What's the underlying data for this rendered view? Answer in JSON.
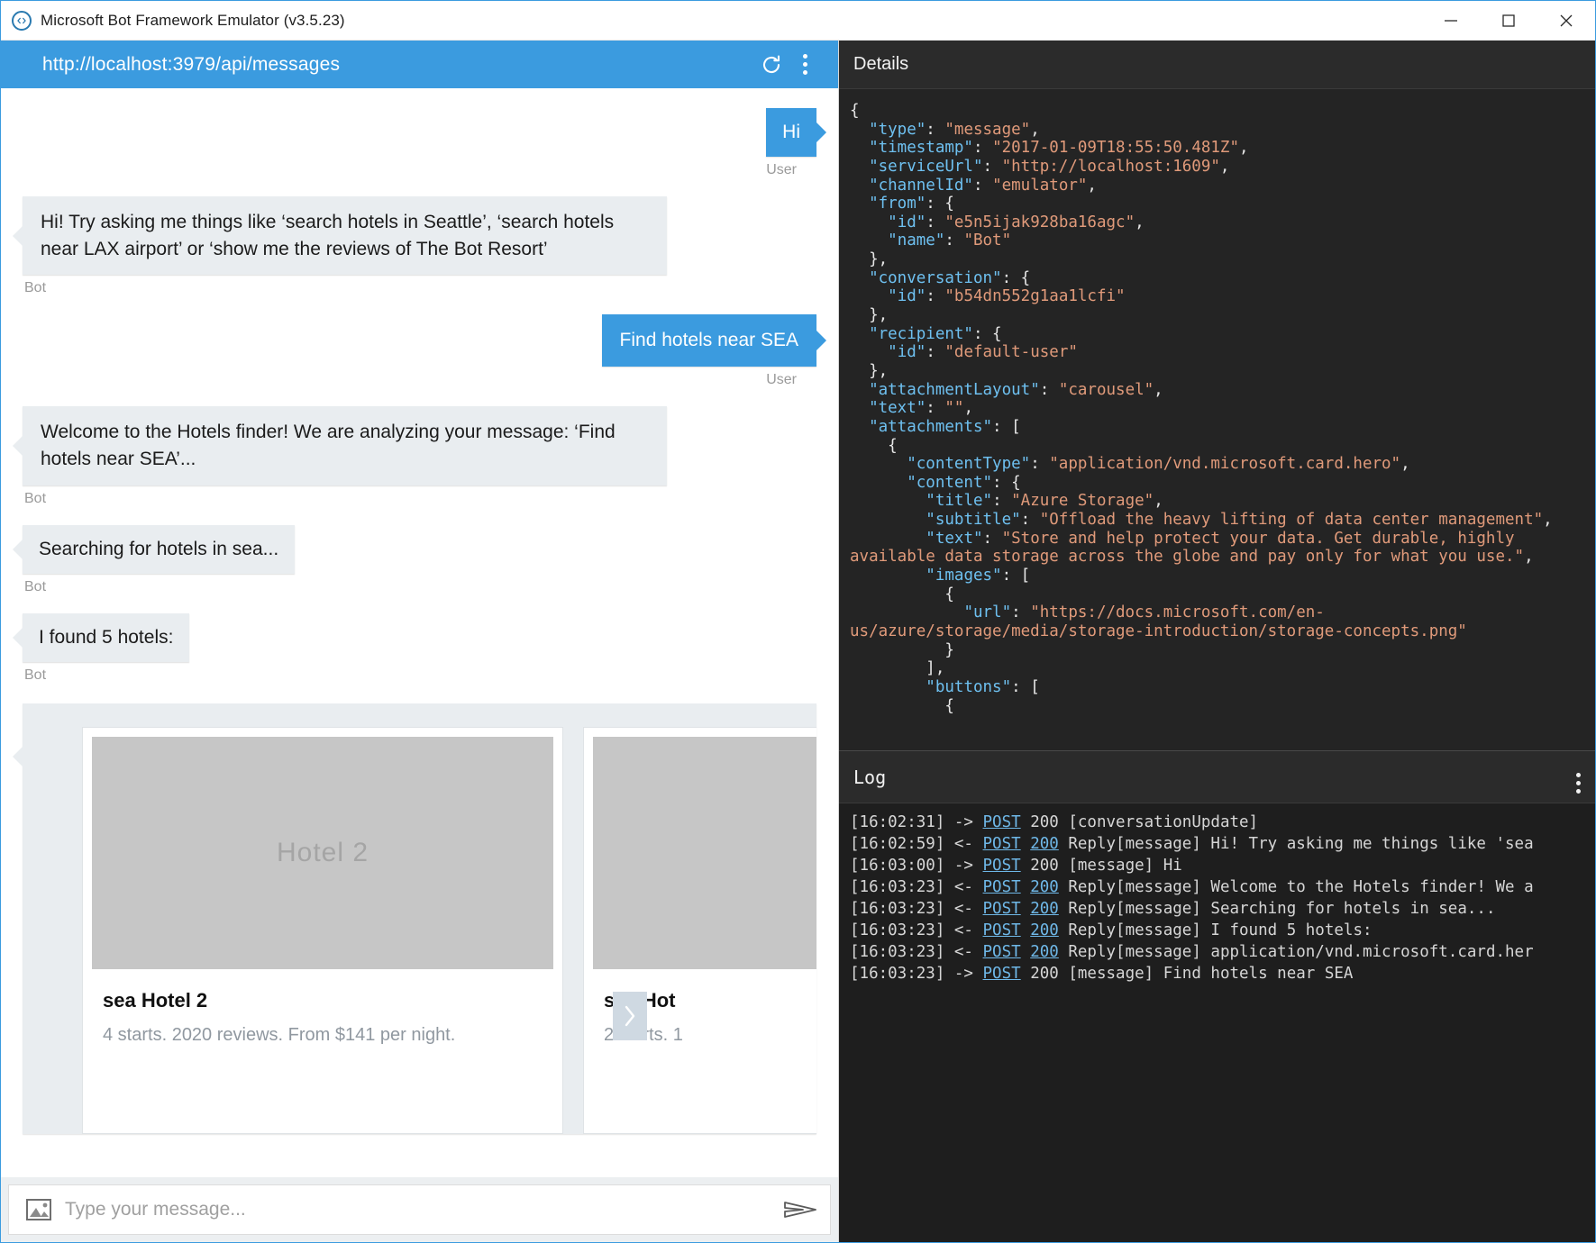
{
  "window": {
    "title": "Microsoft Bot Framework Emulator (v3.5.23)",
    "logo_icon": "bot-framework-logo-icon",
    "minimize_label": "Minimize",
    "maximize_label": "Maximize",
    "close_label": "Close"
  },
  "urlbar": {
    "endpoint": "http://localhost:3979/api/messages",
    "refresh_icon": "refresh-icon",
    "menu_icon": "more-options-icon"
  },
  "chat": {
    "messages": [
      {
        "from": "user",
        "text": "Hi",
        "who": "User"
      },
      {
        "from": "bot",
        "text": "Hi! Try asking me things like ‘search hotels in Seattle’, ‘search hotels near LAX airport’ or ‘show me the reviews of The Bot Resort’",
        "who": "Bot"
      },
      {
        "from": "user",
        "text": "Find hotels near SEA",
        "who": "User"
      },
      {
        "from": "bot",
        "text": "Welcome to the Hotels finder! We are analyzing your message: ‘Find hotels near SEA’...",
        "who": "Bot"
      },
      {
        "from": "bot",
        "text": "Searching for hotels in sea...",
        "who": "Bot"
      },
      {
        "from": "bot",
        "text": "I found 5 hotels:",
        "who": "Bot"
      }
    ],
    "carousel": {
      "next_icon": "chevron-right-icon",
      "cards": [
        {
          "image_label": "Hotel 2",
          "title": "sea Hotel 2",
          "subtitle": "4 starts. 2020 reviews. From $141 per night."
        },
        {
          "image_label": "",
          "title": "sea Hot",
          "subtitle": "2 starts. 1"
        }
      ]
    }
  },
  "composer": {
    "upload_icon": "image-upload-icon",
    "placeholder": "Type your message...",
    "value": "",
    "send_icon": "send-icon"
  },
  "details": {
    "title": "Details",
    "menu_icon": "more-options-icon",
    "json_lines": [
      [
        [
          "p",
          "{"
        ]
      ],
      [
        [
          "p",
          "  "
        ],
        [
          "k",
          "\"type\""
        ],
        [
          "p",
          ": "
        ],
        [
          "s",
          "\"message\""
        ],
        [
          "p",
          ","
        ]
      ],
      [
        [
          "p",
          "  "
        ],
        [
          "k",
          "\"timestamp\""
        ],
        [
          "p",
          ": "
        ],
        [
          "s",
          "\"2017-01-09T18:55:50.481Z\""
        ],
        [
          "p",
          ","
        ]
      ],
      [
        [
          "p",
          "  "
        ],
        [
          "k",
          "\"serviceUrl\""
        ],
        [
          "p",
          ": "
        ],
        [
          "s",
          "\"http://localhost:1609\""
        ],
        [
          "p",
          ","
        ]
      ],
      [
        [
          "p",
          "  "
        ],
        [
          "k",
          "\"channelId\""
        ],
        [
          "p",
          ": "
        ],
        [
          "s",
          "\"emulator\""
        ],
        [
          "p",
          ","
        ]
      ],
      [
        [
          "p",
          "  "
        ],
        [
          "k",
          "\"from\""
        ],
        [
          "p",
          ": {"
        ]
      ],
      [
        [
          "p",
          "    "
        ],
        [
          "k",
          "\"id\""
        ],
        [
          "p",
          ": "
        ],
        [
          "s",
          "\"e5n5ijak928ba16agc\""
        ],
        [
          "p",
          ","
        ]
      ],
      [
        [
          "p",
          "    "
        ],
        [
          "k",
          "\"name\""
        ],
        [
          "p",
          ": "
        ],
        [
          "s",
          "\"Bot\""
        ]
      ],
      [
        [
          "p",
          "  },"
        ]
      ],
      [
        [
          "p",
          "  "
        ],
        [
          "k",
          "\"conversation\""
        ],
        [
          "p",
          ": {"
        ]
      ],
      [
        [
          "p",
          "    "
        ],
        [
          "k",
          "\"id\""
        ],
        [
          "p",
          ": "
        ],
        [
          "s",
          "\"b54dn552g1aa1lcfi\""
        ]
      ],
      [
        [
          "p",
          "  },"
        ]
      ],
      [
        [
          "p",
          "  "
        ],
        [
          "k",
          "\"recipient\""
        ],
        [
          "p",
          ": {"
        ]
      ],
      [
        [
          "p",
          "    "
        ],
        [
          "k",
          "\"id\""
        ],
        [
          "p",
          ": "
        ],
        [
          "s",
          "\"default-user\""
        ]
      ],
      [
        [
          "p",
          "  },"
        ]
      ],
      [
        [
          "p",
          "  "
        ],
        [
          "k",
          "\"attachmentLayout\""
        ],
        [
          "p",
          ": "
        ],
        [
          "s",
          "\"carousel\""
        ],
        [
          "p",
          ","
        ]
      ],
      [
        [
          "p",
          "  "
        ],
        [
          "k",
          "\"text\""
        ],
        [
          "p",
          ": "
        ],
        [
          "s",
          "\"\""
        ],
        [
          "p",
          ","
        ]
      ],
      [
        [
          "p",
          "  "
        ],
        [
          "k",
          "\"attachments\""
        ],
        [
          "p",
          ": ["
        ]
      ],
      [
        [
          "p",
          "    {"
        ]
      ],
      [
        [
          "p",
          "      "
        ],
        [
          "k",
          "\"contentType\""
        ],
        [
          "p",
          ": "
        ],
        [
          "s",
          "\"application/vnd.microsoft.card.hero\""
        ],
        [
          "p",
          ","
        ]
      ],
      [
        [
          "p",
          "      "
        ],
        [
          "k",
          "\"content\""
        ],
        [
          "p",
          ": {"
        ]
      ],
      [
        [
          "p",
          "        "
        ],
        [
          "k",
          "\"title\""
        ],
        [
          "p",
          ": "
        ],
        [
          "s",
          "\"Azure Storage\""
        ],
        [
          "p",
          ","
        ]
      ],
      [
        [
          "p",
          "        "
        ],
        [
          "k",
          "\"subtitle\""
        ],
        [
          "p",
          ": "
        ],
        [
          "s",
          "\"Offload the heavy lifting of data center management\""
        ],
        [
          "p",
          ","
        ]
      ],
      [
        [
          "p",
          "        "
        ],
        [
          "k",
          "\"text\""
        ],
        [
          "p",
          ": "
        ],
        [
          "s",
          "\"Store and help protect your data. Get durable, highly available data storage across the globe and pay only for what you use.\""
        ],
        [
          "p",
          ","
        ]
      ],
      [
        [
          "p",
          "        "
        ],
        [
          "k",
          "\"images\""
        ],
        [
          "p",
          ": ["
        ]
      ],
      [
        [
          "p",
          "          {"
        ]
      ],
      [
        [
          "p",
          "            "
        ],
        [
          "k",
          "\"url\""
        ],
        [
          "p",
          ": "
        ],
        [
          "s",
          "\"https://docs.microsoft.com/en-us/azure/storage/media/storage-introduction/storage-concepts.png\""
        ]
      ],
      [
        [
          "p",
          "          }"
        ]
      ],
      [
        [
          "p",
          "        ],"
        ]
      ],
      [
        [
          "p",
          "        "
        ],
        [
          "k",
          "\"buttons\""
        ],
        [
          "p",
          ": ["
        ]
      ],
      [
        [
          "p",
          "          {"
        ]
      ]
    ]
  },
  "log": {
    "title": "Log",
    "menu_icon": "more-options-icon",
    "entries": [
      {
        "time": "[16:02:31]",
        "dir": "->",
        "method": "POST",
        "status": "200",
        "status_link": false,
        "method_link": true,
        "text": "[conversationUpdate]"
      },
      {
        "time": "[16:02:59]",
        "dir": "<-",
        "method": "POST",
        "status": "200",
        "status_link": true,
        "method_link": true,
        "text": "Reply[message] Hi! Try asking me things like 'sea"
      },
      {
        "time": "[16:03:00]",
        "dir": "->",
        "method": "POST",
        "status": "200",
        "status_link": false,
        "method_link": true,
        "text": "[message] Hi"
      },
      {
        "time": "[16:03:23]",
        "dir": "<-",
        "method": "POST",
        "status": "200",
        "status_link": true,
        "method_link": true,
        "text": "Reply[message] Welcome to the Hotels finder! We a"
      },
      {
        "time": "[16:03:23]",
        "dir": "<-",
        "method": "POST",
        "status": "200",
        "status_link": true,
        "method_link": true,
        "text": "Reply[message] Searching for hotels in sea..."
      },
      {
        "time": "[16:03:23]",
        "dir": "<-",
        "method": "POST",
        "status": "200",
        "status_link": true,
        "method_link": true,
        "text": "Reply[message] I found 5 hotels:"
      },
      {
        "time": "[16:03:23]",
        "dir": "<-",
        "method": "POST",
        "status": "200",
        "status_link": true,
        "method_link": true,
        "text": "Reply[message] application/vnd.microsoft.card.her"
      },
      {
        "time": "[16:03:23]",
        "dir": "->",
        "method": "POST",
        "status": "200",
        "status_link": false,
        "method_link": true,
        "text": "[message] Find hotels near SEA"
      }
    ]
  },
  "colors": {
    "accent": "#3b9bdf",
    "bot_bubble": "#e9edf0",
    "panel_bg": "#2b2b2b",
    "json_bg": "#242424",
    "log_bg": "#1e1e1e",
    "json_key": "#6ec0f0",
    "json_string": "#e09a7a"
  }
}
